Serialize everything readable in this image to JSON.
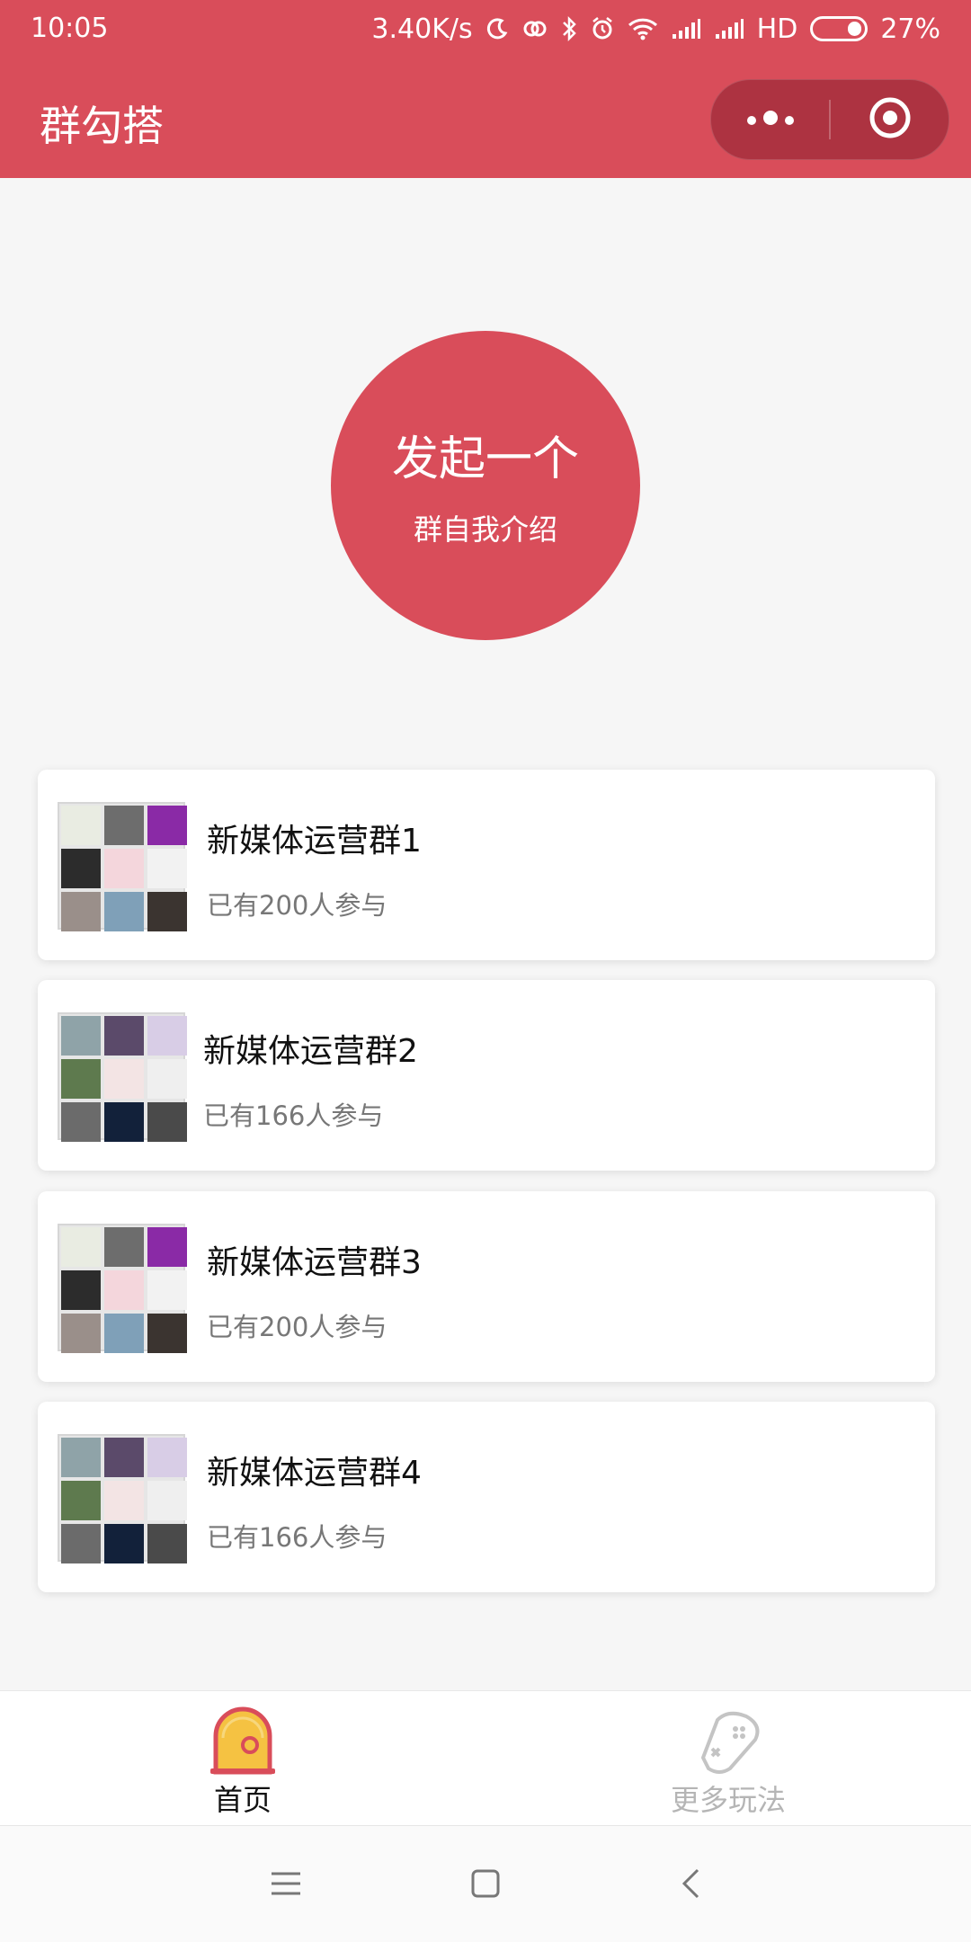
{
  "status_bar": {
    "time": "10:05",
    "speed": "3.40K/s",
    "network": "HD",
    "battery": "27%",
    "battery_level": 0.27,
    "icons": [
      "moon-icon",
      "link-icon",
      "bluetooth-icon",
      "alarm-icon",
      "wifi-icon",
      "signal-icon",
      "signal-icon"
    ]
  },
  "header": {
    "title": "群勾搭",
    "menu_icon": "more-dots-icon",
    "close_icon": "target-close-icon"
  },
  "hero": {
    "line1": "发起一个",
    "line2": "群自我介绍"
  },
  "groups": [
    {
      "name": "新媒体运营群1",
      "count": "已有200人参与"
    },
    {
      "name": "新媒体运营群2",
      "count": "已有166人参与"
    },
    {
      "name": "新媒体运营群3",
      "count": "已有200人参与"
    },
    {
      "name": "新媒体运营群4",
      "count": "已有166人参与"
    }
  ],
  "tabbar": {
    "home": {
      "label": "首页",
      "icon": "home-bell-icon"
    },
    "more": {
      "label": "更多玩法",
      "icon": "gamepad-icon"
    }
  },
  "system_nav": {
    "menu": "menu-icon",
    "home": "home-square-icon",
    "back": "back-icon"
  },
  "colors": {
    "brand": "#d94d5a",
    "background": "#f6f6f6",
    "card": "#ffffff",
    "text_primary": "#111111",
    "text_secondary": "#777777",
    "tab_inactive": "#b5b5b5",
    "accent_yellow": "#f5c242"
  }
}
